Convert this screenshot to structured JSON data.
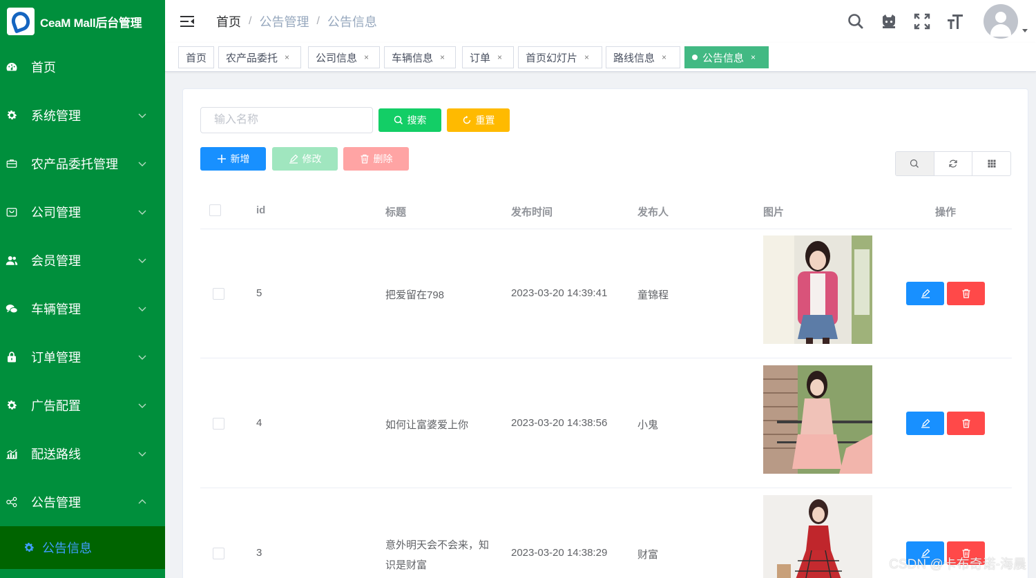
{
  "app": {
    "title": "CeaM Mall后台管理"
  },
  "sidebar": {
    "items": [
      {
        "label": "首页",
        "icon": "dashboard-icon",
        "has_arrow": false
      },
      {
        "label": "系统管理",
        "icon": "gear-icon",
        "has_arrow": true
      },
      {
        "label": "农产品委托管理",
        "icon": "briefcase-icon",
        "has_arrow": true
      },
      {
        "label": "公司管理",
        "icon": "shopping-icon",
        "has_arrow": true
      },
      {
        "label": "会员管理",
        "icon": "users-icon",
        "has_arrow": true
      },
      {
        "label": "车辆管理",
        "icon": "chat-icon",
        "has_arrow": true
      },
      {
        "label": "订单管理",
        "icon": "lock-icon",
        "has_arrow": true
      },
      {
        "label": "广告配置",
        "icon": "cog-icon",
        "has_arrow": true
      },
      {
        "label": "配送路线",
        "icon": "chart-icon",
        "has_arrow": true
      },
      {
        "label": "公告管理",
        "icon": "share-icon",
        "has_arrow": true,
        "expanded": true
      }
    ],
    "active_sub": {
      "label": "公告信息",
      "icon": "cog-icon"
    }
  },
  "breadcrumb": [
    "首页",
    "公告管理",
    "公告信息"
  ],
  "tags": [
    {
      "label": "首页",
      "closable": false
    },
    {
      "label": "农产品委托",
      "closable": true
    },
    {
      "label": "公司信息",
      "closable": true
    },
    {
      "label": "车辆信息",
      "closable": true
    },
    {
      "label": "订单",
      "closable": true
    },
    {
      "label": "首页幻灯片",
      "closable": true
    },
    {
      "label": "路线信息",
      "closable": true
    },
    {
      "label": "公告信息",
      "closable": true,
      "active": true
    }
  ],
  "search": {
    "placeholder": "输入名称",
    "search_label": "搜索",
    "reset_label": "重置"
  },
  "actions": {
    "add_label": "新增",
    "edit_label": "修改",
    "delete_label": "删除"
  },
  "table": {
    "headers": [
      "id",
      "标题",
      "发布时间",
      "发布人",
      "图片",
      "操作"
    ],
    "rows": [
      {
        "id": "5",
        "title_lines": [
          "把爱留在798"
        ],
        "time": "2023-03-20 14:39:41",
        "author": "童锦程"
      },
      {
        "id": "4",
        "title_lines": [
          "如何让富婆爱上你"
        ],
        "time": "2023-03-20 14:38:56",
        "author": "小鬼"
      },
      {
        "id": "3",
        "title_lines": [
          "意外明天会不会来，知",
          "识是财富"
        ],
        "time": "2023-03-20 14:38:29",
        "author": "财富"
      }
    ]
  },
  "watermark": "CSDN @卡布奇诺-海晨",
  "colors": {
    "sidebar": "#008f3c",
    "sidebar_active": "#006400",
    "primary": "#1890ff",
    "success": "#13ce66",
    "warning": "#ffba00",
    "danger": "#ff4949",
    "tag_active": "#42b983"
  }
}
